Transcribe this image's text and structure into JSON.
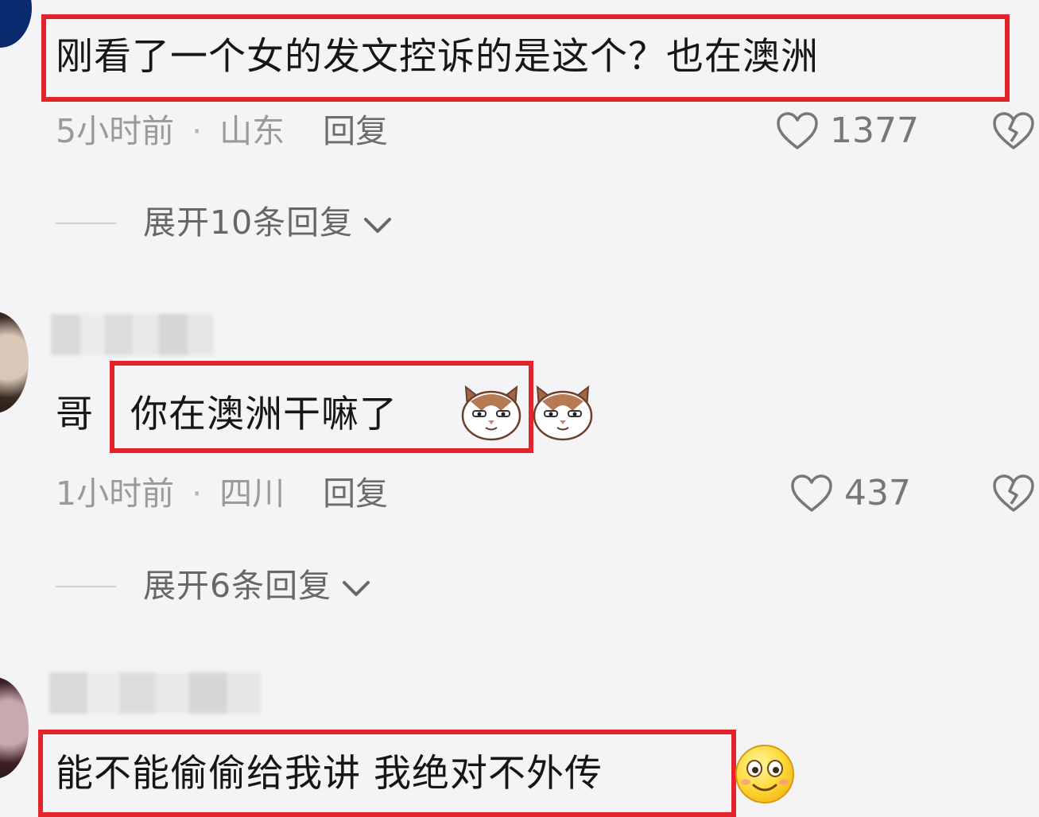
{
  "comments": [
    {
      "text": "刚看了一个女的发文控诉的是这个？也在澳洲",
      "time": "5小时前",
      "location": "山东",
      "reply_label": "回复",
      "likes": "1377",
      "expand_label": "展开10条回复"
    },
    {
      "prefix": "哥",
      "text": "你在澳洲干嘛了",
      "time": "1小时前",
      "location": "四川",
      "reply_label": "回复",
      "likes": "437",
      "expand_label": "展开6条回复"
    },
    {
      "text": "能不能偷偷给我讲 我绝对不外传"
    }
  ],
  "separator": "·",
  "icons": {
    "like": "heart-outline-icon",
    "dislike": "broken-heart-icon",
    "expand": "chevron-down-icon",
    "emoji_cat": "cat-face-emoji",
    "emoji_smile": "smiling-face-emoji"
  },
  "colors": {
    "highlight": "#e5232b",
    "background": "#f4f4f6",
    "meta_text": "#9a9a9a"
  }
}
